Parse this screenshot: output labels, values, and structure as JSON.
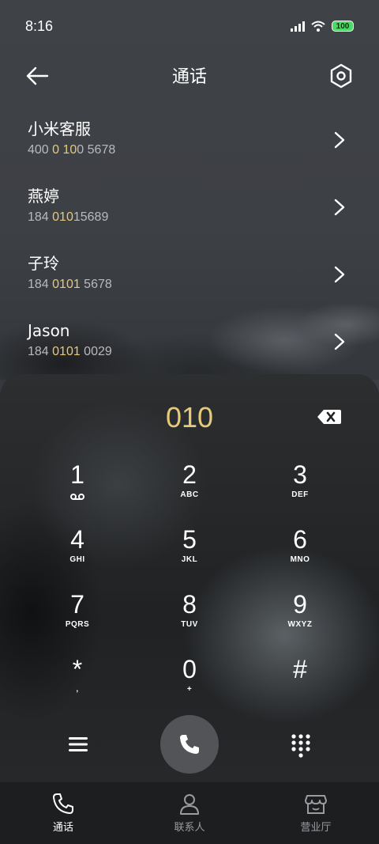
{
  "status_bar": {
    "time": "8:16",
    "battery": "100"
  },
  "header": {
    "title": "通话"
  },
  "contacts": [
    {
      "name": "小米客服",
      "number_parts": [
        "400 ",
        "0",
        " ",
        "10",
        "0 5678"
      ]
    },
    {
      "name": "燕婷",
      "number_parts": [
        "184 ",
        "010",
        "15689"
      ]
    },
    {
      "name": "子玲",
      "number_parts": [
        "184 ",
        "0101",
        " 5678"
      ]
    },
    {
      "name": "Jason",
      "number_parts": [
        "184 ",
        "0101",
        " 0029"
      ]
    }
  ],
  "dial": {
    "input": "010"
  },
  "keypad": [
    {
      "digit": "1",
      "letters": ""
    },
    {
      "digit": "2",
      "letters": "ABC"
    },
    {
      "digit": "3",
      "letters": "DEF"
    },
    {
      "digit": "4",
      "letters": "GHI"
    },
    {
      "digit": "5",
      "letters": "JKL"
    },
    {
      "digit": "6",
      "letters": "MNO"
    },
    {
      "digit": "7",
      "letters": "PQRS"
    },
    {
      "digit": "8",
      "letters": "TUV"
    },
    {
      "digit": "9",
      "letters": "WXYZ"
    },
    {
      "digit": "*",
      "letters": ","
    },
    {
      "digit": "0",
      "letters": "+"
    },
    {
      "digit": "#",
      "letters": ""
    }
  ],
  "nav": [
    {
      "label": "通话",
      "icon": "phone-icon",
      "active": true
    },
    {
      "label": "联系人",
      "icon": "person-icon",
      "active": false
    },
    {
      "label": "营业厅",
      "icon": "store-icon",
      "active": false
    }
  ],
  "colors": {
    "highlight": "#e7c97a",
    "battery": "#4cd964"
  }
}
